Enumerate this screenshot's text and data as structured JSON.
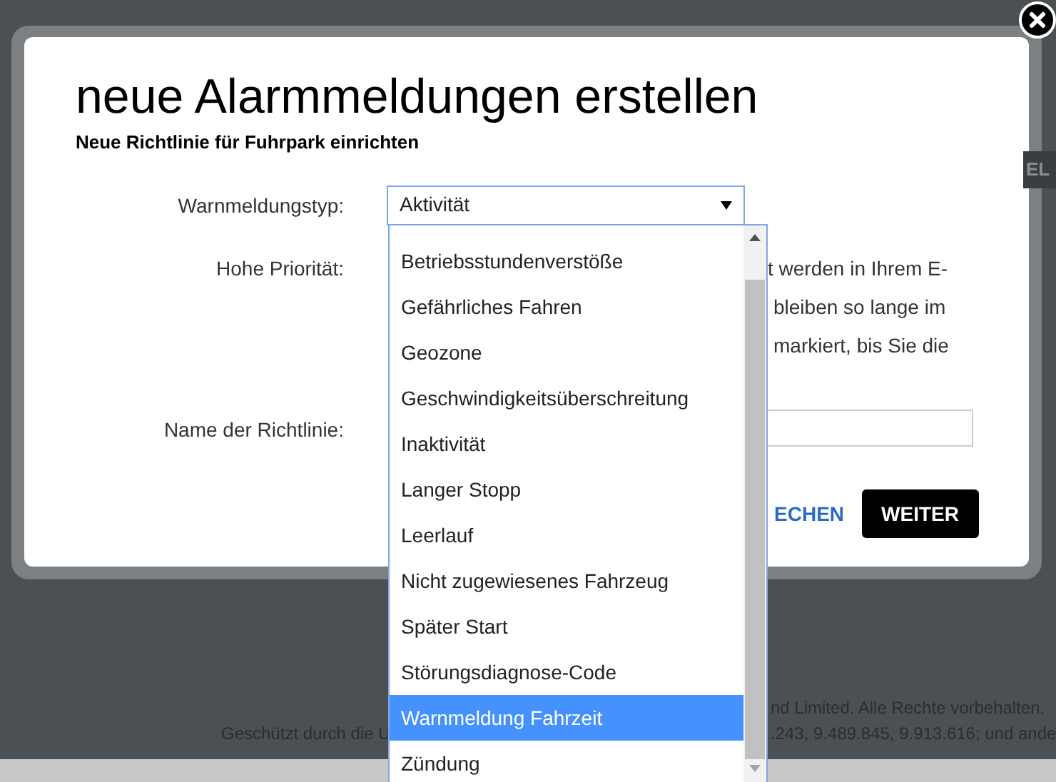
{
  "background": {
    "header_button": "EL",
    "footer": [
      {
        "right": "nd Limited. Alle Rechte vorbehalten."
      },
      {
        "left": "Geschützt durch die U",
        "right": ".243, 9.489.845, 9.913.616; und ande"
      }
    ]
  },
  "dialog": {
    "title": "neue Alarmmeldungen erstellen",
    "subtitle": "Neue Richtlinie für Fuhrpark einrichten",
    "fields": [
      {
        "kind": "select",
        "label": "Warnmeldungstyp:",
        "value": "Aktivität",
        "expanded": true
      },
      {
        "kind": "text",
        "label": "Hohe Priorität:",
        "lines": [
          "t werden in Ihrem E-",
          "bleiben so lange im",
          "markiert, bis Sie die"
        ]
      },
      {
        "kind": "input",
        "label": "Name der Richtlinie:"
      }
    ],
    "options": [
      {
        "label": "Betriebsstundenverstöße",
        "selected": false
      },
      {
        "label": "Gefährliches Fahren",
        "selected": false
      },
      {
        "label": "Geozone",
        "selected": false
      },
      {
        "label": "Geschwindigkeitsüberschreitung",
        "selected": false
      },
      {
        "label": "Inaktivität",
        "selected": false
      },
      {
        "label": "Langer Stopp",
        "selected": false
      },
      {
        "label": "Leerlauf",
        "selected": false
      },
      {
        "label": "Nicht zugewiesenes Fahrzeug",
        "selected": false
      },
      {
        "label": "Später Start",
        "selected": false
      },
      {
        "label": "Störungsdiagnose-Code",
        "selected": false
      },
      {
        "label": "Warnmeldung Fahrzeit",
        "selected": true
      },
      {
        "label": "Zündung",
        "selected": false
      }
    ],
    "buttons": [
      {
        "kind": "link",
        "label": "ECHEN"
      },
      {
        "kind": "primary",
        "label": "WEITER"
      }
    ]
  }
}
